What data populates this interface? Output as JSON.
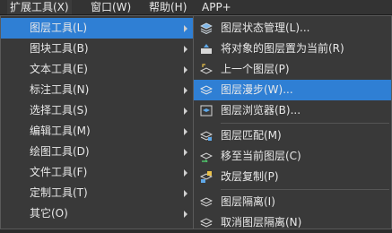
{
  "menubar": {
    "items": [
      {
        "label": "扩展工具(X)"
      },
      {
        "label": "窗口(W)"
      },
      {
        "label": "帮助(H)"
      },
      {
        "label": "APP+"
      }
    ]
  },
  "main_menu": {
    "items": [
      {
        "label": "图层工具(L)"
      },
      {
        "label": "图块工具(B)"
      },
      {
        "label": "文本工具(E)"
      },
      {
        "label": "标注工具(N)"
      },
      {
        "label": "选择工具(S)"
      },
      {
        "label": "编辑工具(M)"
      },
      {
        "label": "绘图工具(D)"
      },
      {
        "label": "文件工具(F)"
      },
      {
        "label": "定制工具(T)"
      },
      {
        "label": "其它(O)"
      }
    ]
  },
  "sub_menu": {
    "items": [
      {
        "label": "图层状态管理(L)...",
        "icon": "layer-state-icon"
      },
      {
        "label": "将对象的图层置为当前(R)",
        "icon": "layer-current-icon"
      },
      {
        "label": "上一个图层(P)",
        "icon": "layer-previous-icon"
      },
      {
        "label": "图层漫步(W)...",
        "icon": "layer-walk-icon"
      },
      {
        "label": "图层浏览器(B)...",
        "icon": "layer-browser-icon"
      },
      {
        "label": "图层匹配(M)",
        "icon": "layer-match-icon"
      },
      {
        "label": "移至当前图层(C)",
        "icon": "move-to-current-layer-icon"
      },
      {
        "label": "改层复制(P)",
        "icon": "copy-to-layer-icon"
      },
      {
        "label": "图层隔离(I)",
        "icon": "layer-isolate-icon"
      },
      {
        "label": "取消图层隔离(N)",
        "icon": "layer-unisolate-icon"
      }
    ]
  },
  "colors": {
    "highlight": "#2f7fd4",
    "menu_bg": "#393939",
    "menubar_bg": "#333333"
  }
}
